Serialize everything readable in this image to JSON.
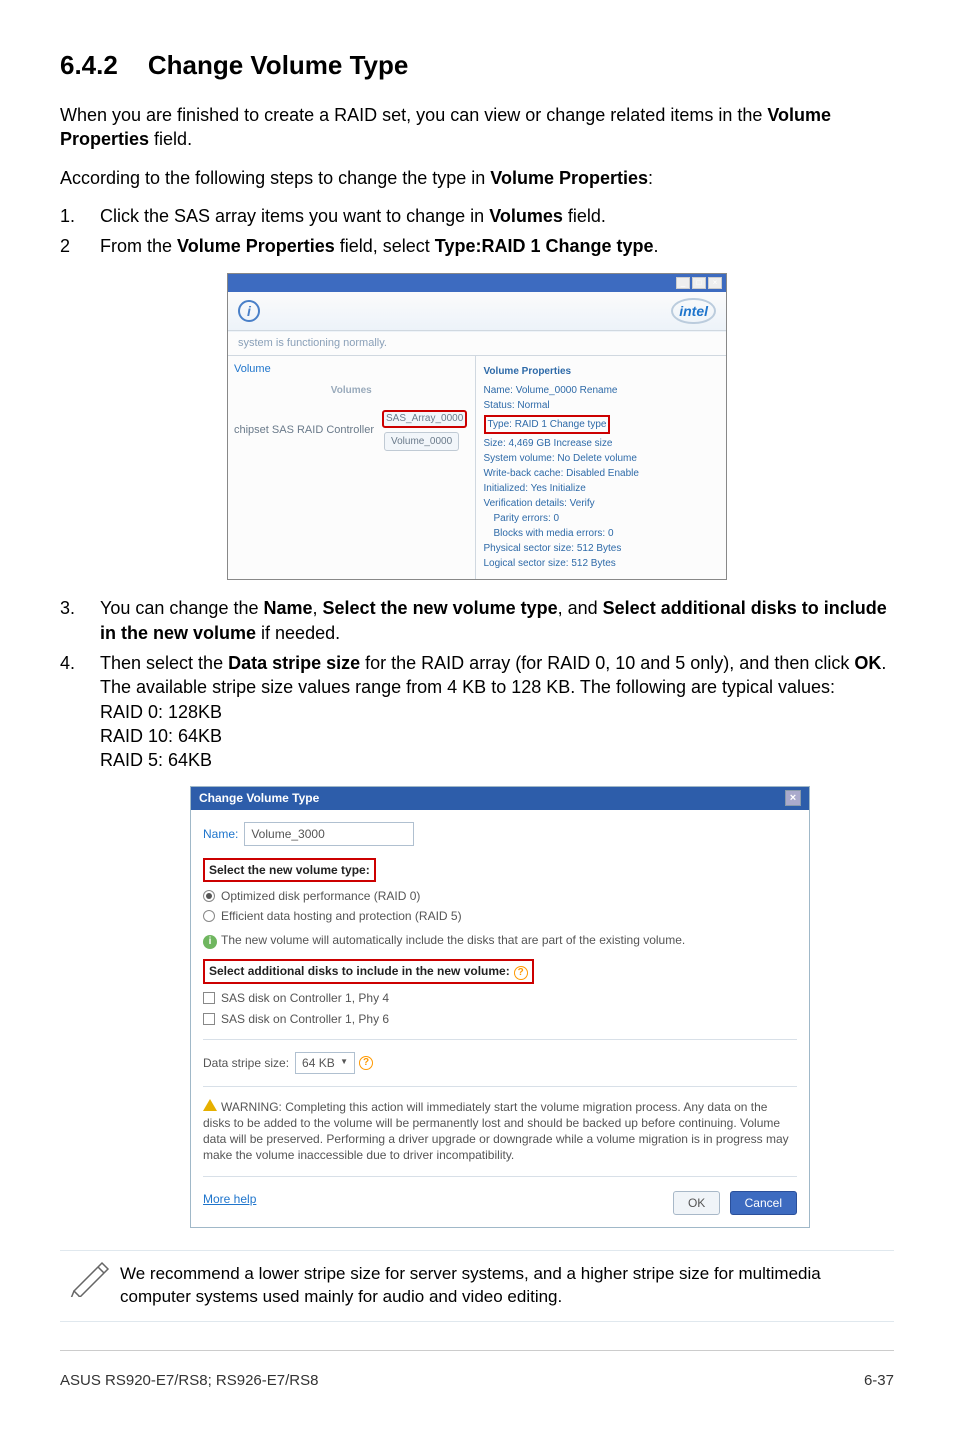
{
  "section": {
    "number": "6.4.2",
    "title": "Change Volume Type"
  },
  "intro1_a": "When you are finished to create a RAID set, you can view or change related items in the ",
  "intro1_b": "Volume Properties",
  "intro1_c": " field.",
  "intro2_a": "According to the following steps to change the type in ",
  "intro2_b": "Volume Properties",
  "intro2_c": ":",
  "step1": {
    "n": "1.",
    "t_a": "Click the SAS array items you want to change in ",
    "t_b": "Volumes",
    "t_c": " field."
  },
  "step2": {
    "n": "2",
    "t_a": "From the ",
    "t_b": "Volume Properties",
    "t_c": " field, select ",
    "t_d": "Type:RAID 1 Change type",
    "t_e": "."
  },
  "ss1": {
    "status": "system is functioning normally.",
    "intel": "intel",
    "left_title": "Volume",
    "volumes_label": "Volumes",
    "controller": "chipset SAS RAID Controller",
    "array_chip": "SAS_Array_0000",
    "vol_chip": "Volume_0000",
    "right": {
      "title": "Volume Properties",
      "name": "Name: Volume_0000 Rename",
      "status": "Status: Normal",
      "type": "Type: RAID 1 Change type",
      "size": "Size: 4,469 GB Increase size",
      "sysvol": "System volume: No Delete volume",
      "cache": "Write-back cache: Disabled Enable",
      "init": "Initialized: Yes Initialize",
      "verify": "Verification details: Verify",
      "parity": "Parity errors: 0",
      "blocks": "Blocks with media errors: 0",
      "phys": "Physical sector size: 512 Bytes",
      "log": "Logical sector size: 512 Bytes"
    }
  },
  "step3": {
    "n": "3.",
    "a": "You can change the ",
    "b": "Name",
    "c": ", ",
    "d": "Select the new volume type",
    "e": ", and ",
    "f": "Select additional disks to include in the new volume",
    "g": " if needed."
  },
  "step4": {
    "n": "4.",
    "a": "Then select the ",
    "b": "Data stripe size",
    "c": " for the RAID array (for RAID 0, 10 and 5 only), and then click ",
    "d": "OK",
    "e": ". The available stripe size values range from 4 KB to 128 KB. The following are typical values:",
    "l1": "RAID 0: 128KB",
    "l2": "RAID 10: 64KB",
    "l3": "RAID 5: 64KB"
  },
  "dlg": {
    "title": "Change Volume Type",
    "name_label": "Name:",
    "name_value": "Volume_3000",
    "sect1": "Select the new volume type:",
    "r1": "Optimized disk performance (RAID 0)",
    "r2": "Efficient data hosting and protection (RAID 5)",
    "note1": "The new volume will automatically include the disks that are part of the existing volume.",
    "sect2": "Select additional disks to include in the new volume:",
    "c1": "SAS disk on Controller 1, Phy 4",
    "c2": "SAS disk on Controller 1, Phy 6",
    "stripe_label": "Data stripe size:",
    "stripe_value": "64 KB",
    "warn": "WARNING: Completing this action will immediately start the volume migration process. Any data on the disks to be added to the volume will be permanently lost and should be backed up before continuing. Volume data will be preserved. Performing a driver upgrade or downgrade while a volume migration is in progress may make the volume inaccessible due to driver incompatibility.",
    "more": "More help",
    "ok": "OK",
    "cancel": "Cancel"
  },
  "note": "We recommend a lower stripe size for server systems, and a higher stripe size for multimedia computer systems used mainly for audio and video editing.",
  "footer": {
    "left": "ASUS RS920-E7/RS8; RS926-E7/RS8",
    "right": "6-37"
  }
}
